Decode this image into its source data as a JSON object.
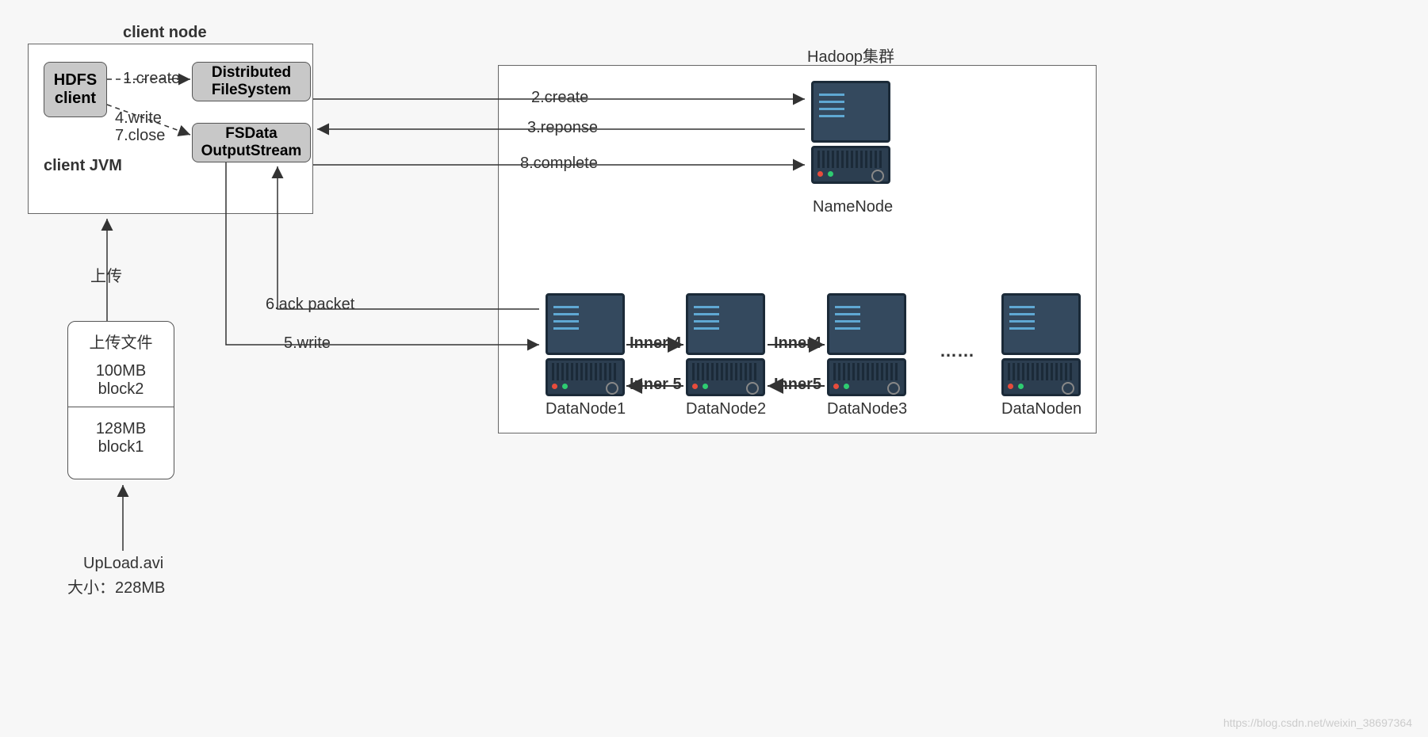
{
  "client_node": {
    "title": "client node",
    "jvm_label": "client JVM",
    "hdfs_client": "HDFS\nclient",
    "distributed_fs": "Distributed\nFileSystem",
    "fsdata_output": "FSData\nOutputStream"
  },
  "hadoop": {
    "title": "Hadoop集群",
    "namenode": "NameNode",
    "datanode1": "DataNode1",
    "datanode2": "DataNode2",
    "datanode3": "DataNode3",
    "datanoden": "DataNoden",
    "ellipsis": "……"
  },
  "steps": {
    "s1": "1.create",
    "s2": "2.create",
    "s3": "3.reponse",
    "s4": "4.write",
    "s5": "5.write",
    "s6": "6.ack packet",
    "s7": "7.close",
    "s8": "8.complete",
    "inner4a": "Inner 4",
    "inner4b": "Inner4",
    "inner5a": "Inner 5",
    "inner5b": "Inner5"
  },
  "upload": {
    "arrow_label": "上传",
    "box_title": "上传文件",
    "block2": "100MB\nblock2",
    "block1": "128MB\nblock1",
    "filename": "UpLoad.avi",
    "size": "大小：228MB"
  },
  "watermark": "https://blog.csdn.net/weixin_38697364"
}
